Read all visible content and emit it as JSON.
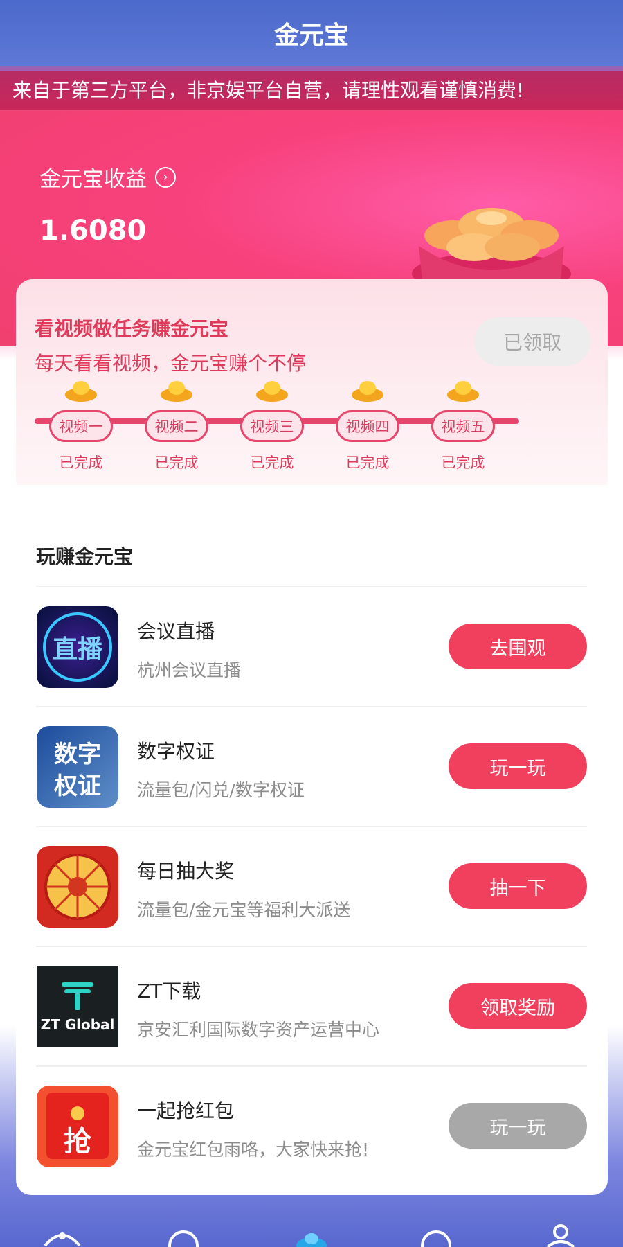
{
  "header": {
    "title": "金元宝"
  },
  "notice": {
    "text": "来自于第三方平台，非京娱平台自营，请理性观看谨慎消费!"
  },
  "earnings": {
    "label": "金元宝收益",
    "value": "1.6080"
  },
  "task": {
    "title": "看视频做任务赚金元宝",
    "subtitle": "每天看看视频，金元宝赚个不停",
    "claim_button": "已领取",
    "steps": [
      {
        "label": "视频一",
        "status": "已完成"
      },
      {
        "label": "视频二",
        "status": "已完成"
      },
      {
        "label": "视频三",
        "status": "已完成"
      },
      {
        "label": "视频四",
        "status": "已完成"
      },
      {
        "label": "视频五",
        "status": "已完成"
      }
    ]
  },
  "section": {
    "title": "玩赚金元宝"
  },
  "items": [
    {
      "name": "会议直播",
      "desc": "杭州会议直播",
      "button": "去围观",
      "icon_text": "直播",
      "icon": "live-icon",
      "button_state": "active"
    },
    {
      "name": "数字权证",
      "desc": "流量包/闪兑/数字权证",
      "button": "玩一玩",
      "icon_text": "数字权证",
      "icon": "digital-warrant-icon",
      "button_state": "active"
    },
    {
      "name": "每日抽大奖",
      "desc": "流量包/金元宝等福利大派送",
      "button": "抽一下",
      "icon_text": "",
      "icon": "prize-wheel-icon",
      "button_state": "active"
    },
    {
      "name": "ZT下载",
      "desc": "京安汇利国际数字资产运营中心",
      "button": "领取奖励",
      "icon_text": "ZT Global",
      "icon": "zt-global-icon",
      "button_state": "active"
    },
    {
      "name": "一起抢红包",
      "desc": "金元宝红包雨咯，大家快来抢!",
      "button": "玩一玩",
      "icon_text": "抢",
      "icon": "red-envelope-icon",
      "button_state": "disabled"
    }
  ],
  "colors": {
    "accent": "#f1405e",
    "header": "#4b6acb",
    "disabled": "#a8a8a8"
  }
}
